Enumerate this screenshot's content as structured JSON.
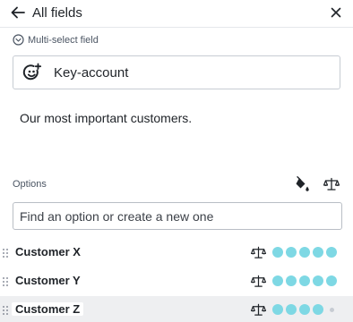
{
  "header": {
    "title": "All fields"
  },
  "field": {
    "type_label": "Multi-select field",
    "name": "Key-account",
    "description": "Our most important customers."
  },
  "options": {
    "label": "Options",
    "search_placeholder": "Find an option or create a new one",
    "max_rating": 5,
    "items": [
      {
        "label": "Customer X",
        "rating": 5
      },
      {
        "label": "Customer Y",
        "rating": 5
      },
      {
        "label": "Customer Z",
        "rating": 4
      }
    ]
  },
  "colors": {
    "accent_dot": "#7ed8e4",
    "hover_row": "#eeeff1"
  }
}
